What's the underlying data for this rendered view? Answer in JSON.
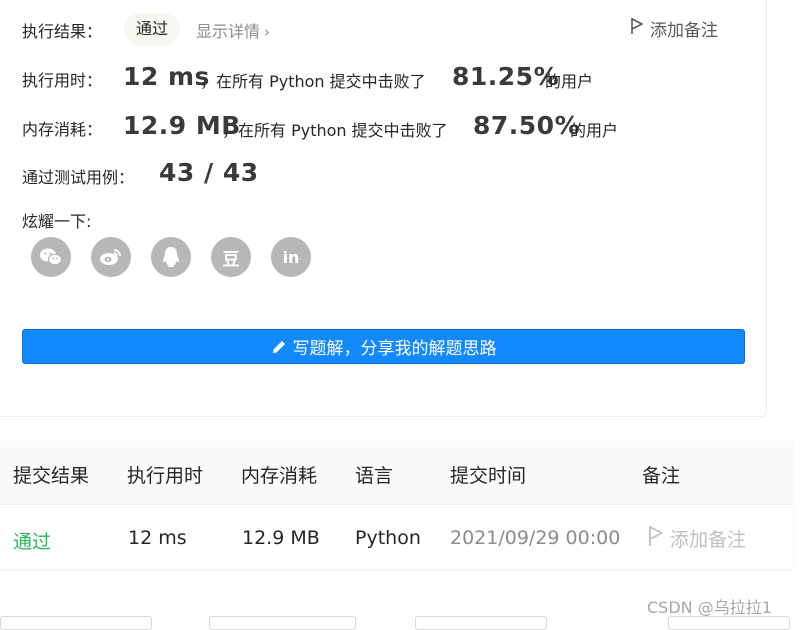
{
  "summary": {
    "result_label": "执行结果：",
    "result_badge": "通过",
    "details_link": "显示详情",
    "details_chevron": "›",
    "add_note": "添加备注",
    "runtime_label": "执行用时：",
    "runtime_value": "12 ms",
    "runtime_text": "，在所有 Python 提交中击败了",
    "runtime_percent": "81.25%",
    "runtime_suffix": "的用户",
    "memory_label": "内存消耗：",
    "memory_value": "12.9 MB",
    "memory_text": "，在所有 Python 提交中击败了",
    "memory_percent": "87.50%",
    "memory_suffix": "的用户",
    "tests_label": "通过测试用例：",
    "tests_value": "43 / 43",
    "share_label": "炫耀一下:",
    "share_icons": [
      "wechat-icon",
      "weibo-icon",
      "qq-icon",
      "douban-icon",
      "linkedin-icon"
    ],
    "douban_glyph": "豆",
    "linkedin_glyph": "in",
    "solution_button": "写题解，分享我的解题思路"
  },
  "table": {
    "headers": [
      "提交结果",
      "执行用时",
      "内存消耗",
      "语言",
      "提交时间",
      "备注"
    ],
    "rows": [
      {
        "status": "通过",
        "runtime": "12 ms",
        "memory": "12.9 MB",
        "language": "Python",
        "time": "2021/09/29 00:00",
        "note": "添加备注"
      }
    ]
  },
  "watermark": "CSDN @乌拉拉1",
  "colors": {
    "accent": "#1389ff",
    "pass_green": "#2db55d",
    "icon_gray": "#b7b7b7"
  }
}
